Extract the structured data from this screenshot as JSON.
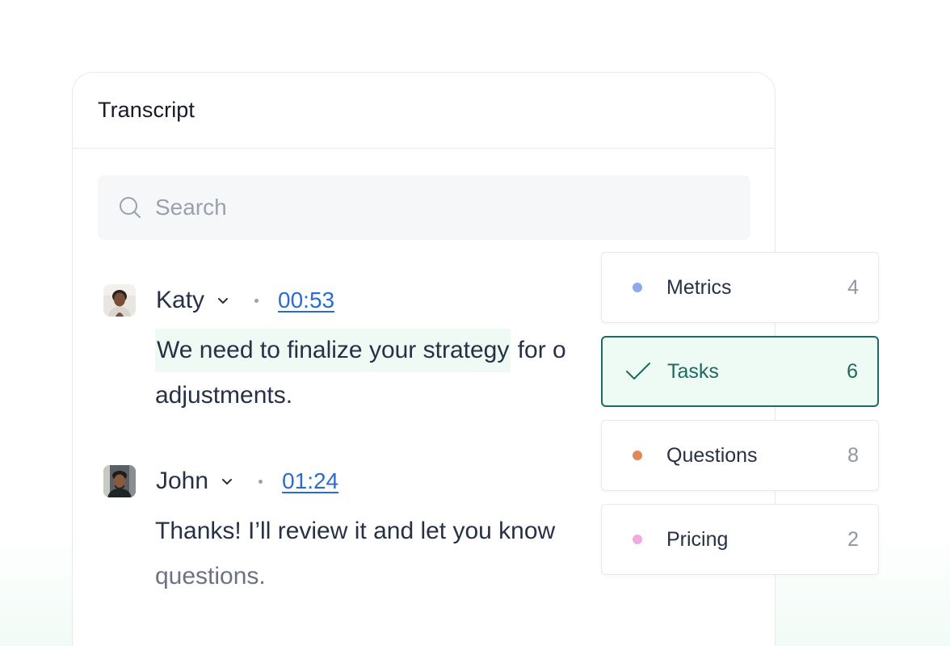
{
  "panel": {
    "title": "Transcript",
    "search": {
      "placeholder": "Search",
      "value": ""
    },
    "entries": [
      {
        "speaker": "Katy",
        "timestamp": "00:53",
        "text_highlighted": "We need to finalize your strategy",
        "text_rest": " for o",
        "text_line2": "adjustments."
      },
      {
        "speaker": "John",
        "timestamp": "01:24",
        "text_line1": "Thanks! I’ll review it and let you know",
        "text_line2": "questions."
      }
    ]
  },
  "categories": [
    {
      "label": "Metrics",
      "count": "4",
      "color": "#8fa9ee",
      "selected": false
    },
    {
      "label": "Tasks",
      "count": "6",
      "color": "#1d6b5c",
      "selected": true
    },
    {
      "label": "Questions",
      "count": "8",
      "color": "#df8a56",
      "selected": false
    },
    {
      "label": "Pricing",
      "count": "2",
      "color": "#f2a9e2",
      "selected": false
    }
  ]
}
